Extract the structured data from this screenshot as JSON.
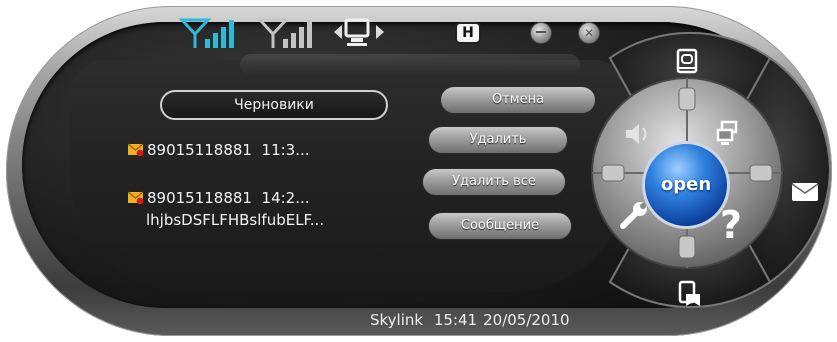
{
  "top_bar": {
    "signal_1_color": "#2fb8d8",
    "signal_2_color": "#bdbdbd",
    "connection_icon": "computer-connection-icon",
    "h_label": "H",
    "minimize_icon": "minimize-icon",
    "close_icon": "close-icon"
  },
  "folder": {
    "title": "Черновики"
  },
  "messages": [
    {
      "number": "89015118881",
      "time": "11:3...",
      "preview": ""
    },
    {
      "number": "89015118881",
      "time": "14:2...",
      "preview": "lhjbsDSFLFHBslfubELF..."
    }
  ],
  "actions": {
    "cancel": "Отмена",
    "delete": "Удалить",
    "delete_all": "Удалить все",
    "message": "Сообщение"
  },
  "status_bar": {
    "operator": "Skylink",
    "time": "15:41",
    "date": "20/05/2010"
  },
  "wheel": {
    "center_label": "open",
    "accent_color": "#1b5fc8",
    "icons": [
      "phonebook-icon",
      "volume-icon",
      "network-icon",
      "settings-icon",
      "help-icon",
      "sms-envelope-icon",
      "bookmark-icon"
    ]
  }
}
